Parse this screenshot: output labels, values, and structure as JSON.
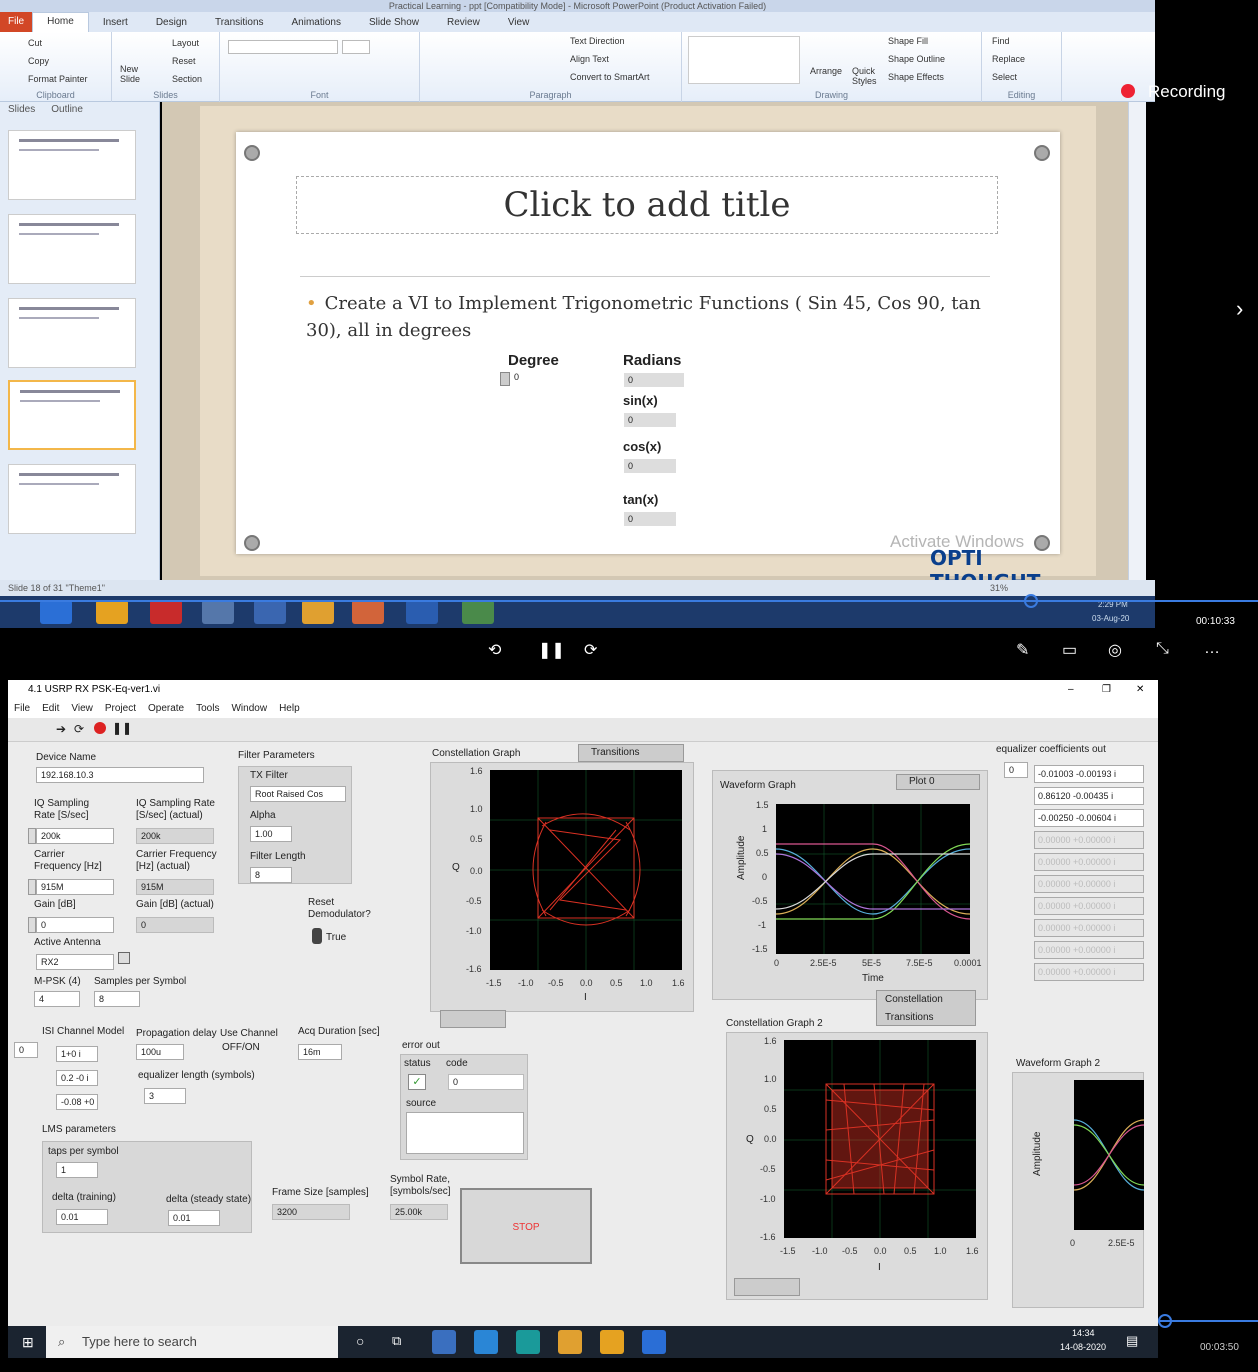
{
  "powerpoint": {
    "title_text": "Practical Learning - ppt [Compatibility Mode] - Microsoft PowerPoint (Product Activation Failed)",
    "tabs": [
      "File",
      "Home",
      "Insert",
      "Design",
      "Transitions",
      "Animations",
      "Slide Show",
      "Review",
      "View"
    ],
    "clipboard": {
      "cut": "Cut",
      "copy": "Copy",
      "format_painter": "Format Painter",
      "label": "Clipboard"
    },
    "slides_group": {
      "new_slide": "New Slide",
      "layout": "Layout",
      "reset": "Reset",
      "section": "Section",
      "label": "Slides"
    },
    "font_label": "Font",
    "paragraph_label": "Paragraph",
    "drawing_label": "Drawing",
    "drawing": {
      "arrange": "Arrange",
      "quick_styles": "Quick Styles",
      "shape_fill": "Shape Fill",
      "shape_outline": "Shape Outline",
      "shape_effects": "Shape Effects"
    },
    "paragraph": {
      "text_direction": "Text Direction",
      "align_text": "Align Text",
      "convert": "Convert to SmartArt"
    },
    "editing": {
      "find": "Find",
      "replace": "Replace",
      "select": "Select",
      "label": "Editing"
    },
    "left_tabs": [
      "Slides",
      "Outline"
    ],
    "slide_title_placeholder": "Click to add title",
    "bullet": "Create a VI to Implement Trigonometric Functions ( Sin 45, Cos 90, tan 30), all in degrees",
    "vi": {
      "degree_label": "Degree",
      "degree_value": "0",
      "radians_label": "Radians",
      "radians_value": "0",
      "sin_label": "sin(x)",
      "sin_value": "0",
      "cos_label": "cos(x)",
      "cos_value": "0",
      "tan_label": "tan(x)",
      "tan_value": "0"
    },
    "status_text": "Slide 18 of 31   \"Theme1\"",
    "zoom": "31%",
    "recording_label": "Recording",
    "watermark": "Activate Windows",
    "brand": "OPTI THOUGHT",
    "clock": {
      "time": "2:29 PM",
      "date": "03-Aug-20"
    },
    "video_time": "00:10:33"
  },
  "labview": {
    "window_title": "4.1 USRP RX PSK-Eq-ver1.vi",
    "menu": [
      "File",
      "Edit",
      "View",
      "Project",
      "Operate",
      "Tools",
      "Window",
      "Help"
    ],
    "device_name_label": "Device Name",
    "device_name_value": "192.168.10.3",
    "iq_rate_label": "IQ Sampling Rate [S/sec]",
    "iq_rate_value": "200k",
    "iq_rate_actual_label": "IQ Sampling Rate [S/sec] (actual)",
    "iq_rate_actual_value": "200k",
    "carrier_label": "Carrier Frequency [Hz]",
    "carrier_value": "915M",
    "carrier_actual_label": "Carrier Frequency [Hz] (actual)",
    "carrier_actual_value": "915M",
    "gain_label": "Gain [dB]",
    "gain_value": "0",
    "gain_actual_label": "Gain [dB] (actual)",
    "gain_actual_value": "0",
    "antenna_label": "Active Antenna",
    "antenna_value": "RX2",
    "mpsk_label": "M-PSK (4)",
    "mpsk_value": "4",
    "sps_label": "Samples per Symbol",
    "sps_value": "8",
    "filter_params_label": "Filter Parameters",
    "tx_filter_label": "TX Filter",
    "tx_filter_value": "Root Raised Cos",
    "alpha_label": "Alpha",
    "alpha_value": "1.00",
    "filter_length_label": "Filter Length",
    "filter_length_value": "8",
    "reset_demod_label": "Reset Demodulator?",
    "reset_demod_value": "True",
    "isi_label": "ISI Channel Model",
    "isi_index": "0",
    "isi_values": [
      "1+0 i",
      "0.2 -0 i",
      "-0.08 +0"
    ],
    "prop_delay_label": "Propagation delay",
    "prop_delay_value": "100u",
    "use_channel_label": "Use Channel",
    "use_channel_value": "OFF/ON",
    "acq_label": "Acq Duration [sec]",
    "acq_value": "16m",
    "eq_len_label": "equalizer length (symbols)",
    "eq_len_value": "3",
    "lms_label": "LMS parameters",
    "taps_label": "taps per symbol",
    "taps_value": "1",
    "delta_train_label": "delta (training)",
    "delta_train_value": "0.01",
    "delta_steady_label": "delta (steady state)",
    "delta_steady_value": "0.01",
    "frame_label": "Frame Size [samples]",
    "frame_value": "3200",
    "symrate_label": "Symbol Rate, [symbols/sec]",
    "symrate_value": "25.00k",
    "stop_label": "STOP",
    "error_out_label": "error out",
    "status_label": "status",
    "code_label": "code",
    "code_value": "0",
    "source_label": "source",
    "constellation_title": "Constellation Graph",
    "transitions_label": "Transitions",
    "constellation2_title": "Constellation Graph 2",
    "constellation_legend": "Constellation",
    "transitions_legend": "Transitions",
    "waveform_title": "Waveform Graph",
    "plot0_label": "Plot 0",
    "waveform2_title": "Waveform Graph 2",
    "amplitude_label": "Amplitude",
    "time_label": "Time",
    "q_label": "Q",
    "i_label": "I",
    "const_x_ticks": [
      "-1.5",
      "-1.0",
      "-0.5",
      "0.0",
      "0.5",
      "1.0",
      "1.6"
    ],
    "const_y_ticks": [
      "1.6",
      "1.0",
      "0.5",
      "0.0",
      "-0.5",
      "-1.0",
      "-1.6"
    ],
    "wave_x_ticks": [
      "0",
      "2.5E-5",
      "5E-5",
      "7.5E-5",
      "0.0001"
    ],
    "wave_y_ticks": [
      "1.5",
      "1",
      "0.5",
      "0",
      "-0.5",
      "-1",
      "-1.5"
    ],
    "wave2_x_ticks": [
      "0",
      "2.5E-5"
    ],
    "eq_coeff_label": "equalizer coefficients out",
    "eq_index": "0",
    "eq_values": [
      "-0.01003 -0.00193 i",
      "0.86120 -0.00435 i",
      "-0.00250 -0.00604 i",
      "0.00000 +0.00000 i",
      "0.00000 +0.00000 i",
      "0.00000 +0.00000 i",
      "0.00000 +0.00000 i",
      "0.00000 +0.00000 i",
      "0.00000 +0.00000 i",
      "0.00000 +0.00000 i"
    ],
    "taskbar_search": "Type here to search",
    "clock": {
      "time": "14:34",
      "date": "14-08-2020"
    },
    "video_time": "00:03:50"
  }
}
